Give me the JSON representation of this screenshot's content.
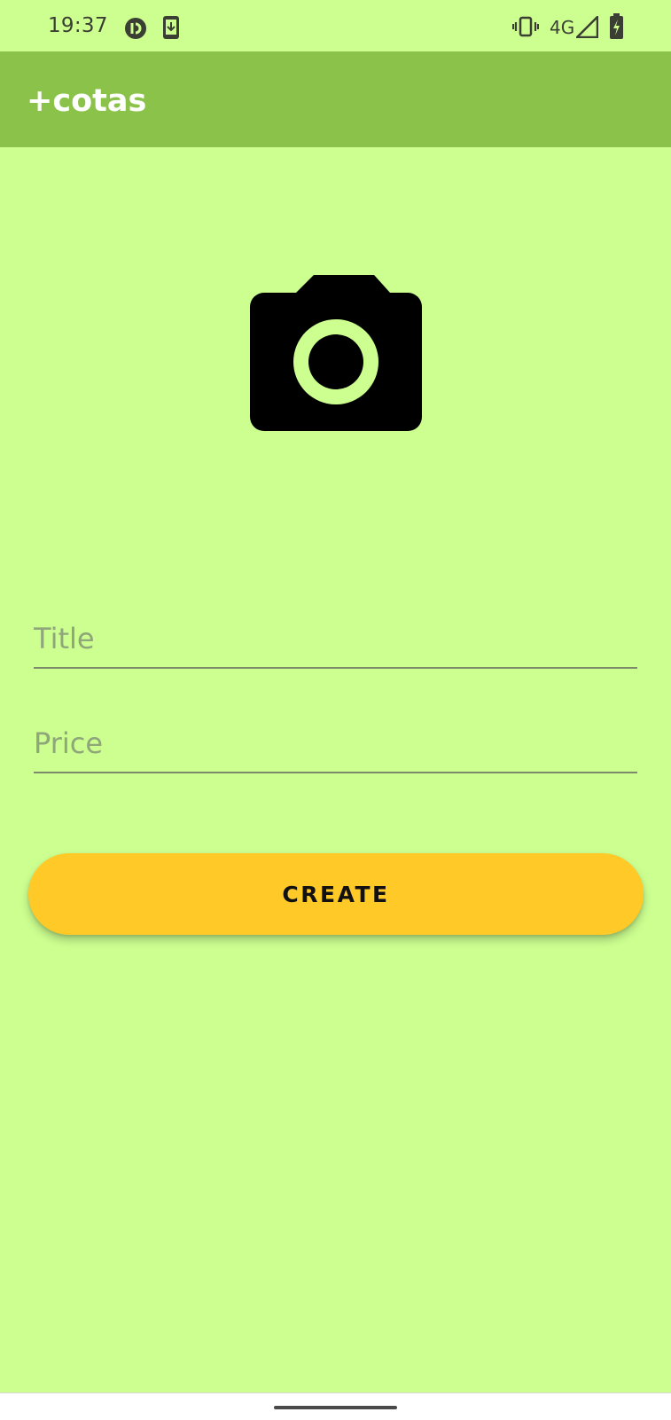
{
  "status_bar": {
    "time": "19:37",
    "network_label": "4G",
    "icons": [
      "circle-app-icon",
      "download-icon",
      "vibrate-icon",
      "signal-icon",
      "battery-charging-icon"
    ]
  },
  "app_bar": {
    "title": "+cotas",
    "color": "#8bc34a"
  },
  "form": {
    "image_picker_icon": "camera-icon",
    "title_placeholder": "Title",
    "title_value": "",
    "price_placeholder": "Price",
    "price_value": "",
    "create_label": "CREATE",
    "button_color": "#ffca28"
  },
  "theme": {
    "background": "#ccff90",
    "accent": "#8bc34a"
  }
}
